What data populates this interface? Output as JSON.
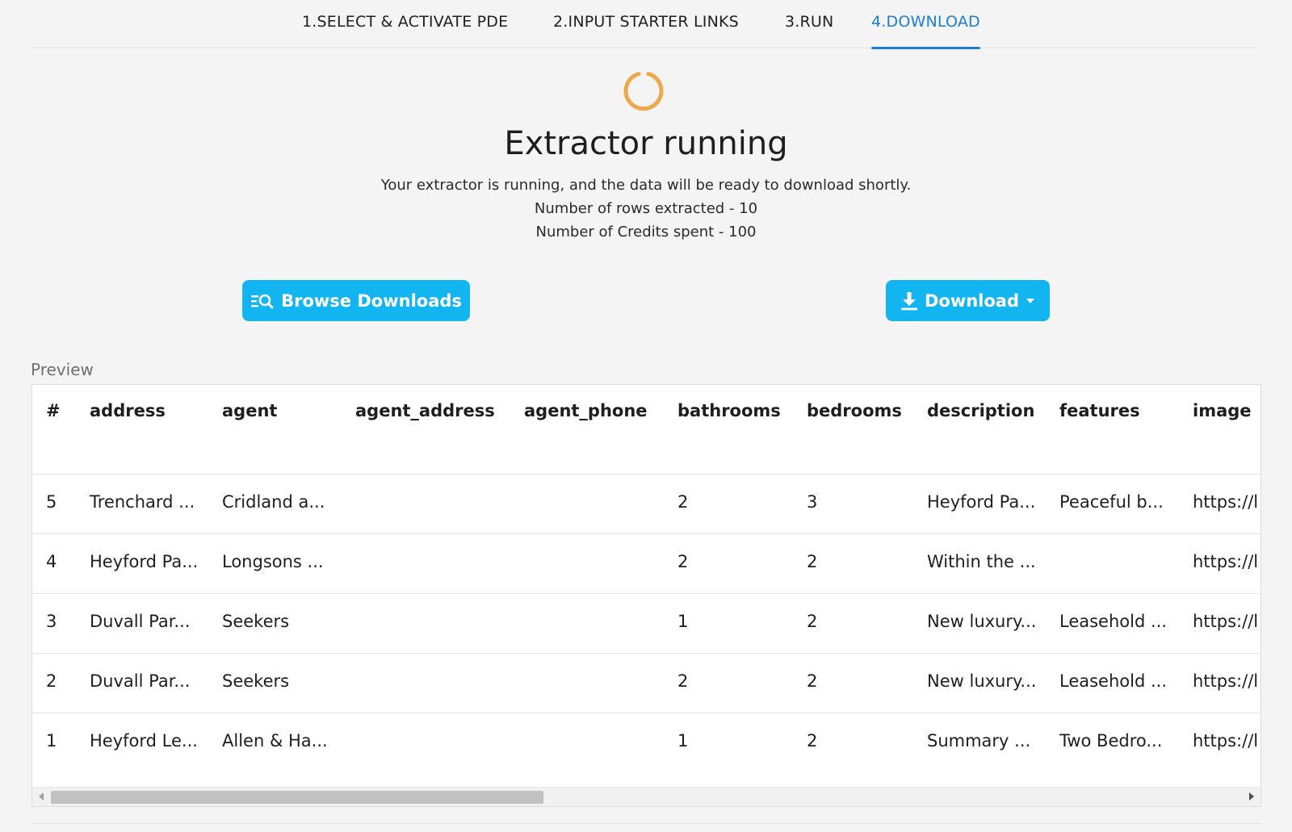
{
  "tabs": [
    {
      "label": "1.SELECT & ACTIVATE PDE"
    },
    {
      "label": "2.INPUT STARTER LINKS"
    },
    {
      "label": "3.RUN"
    },
    {
      "label": "4.DOWNLOAD",
      "active": true
    }
  ],
  "status": {
    "title": "Extractor running",
    "message": "Your extractor is running, and the data will be ready to download shortly.",
    "rows_extracted": "Number of rows extracted - 10",
    "credits_spent": "Number of Credits spent - 100"
  },
  "buttons": {
    "browse_label": "Browse Downloads",
    "download_label": "Download"
  },
  "preview": {
    "label": "Preview",
    "columns": [
      "#",
      "address",
      "agent",
      "agent_address",
      "agent_phone",
      "bathrooms",
      "bedrooms",
      "description",
      "features",
      "image"
    ],
    "rows": [
      [
        "5",
        "Trenchard ...",
        "Cridland a...",
        "",
        "",
        "2",
        "3",
        "Heyford Pa...",
        "Peaceful b...",
        "https://l"
      ],
      [
        "4",
        "Heyford Pa...",
        "Longsons ...",
        "",
        "",
        "2",
        "2",
        "Within the ...",
        "",
        "https://l"
      ],
      [
        "3",
        "Duvall Par...",
        "Seekers",
        "",
        "",
        "1",
        "2",
        "New luxury...",
        "Leasehold ...",
        "https://l"
      ],
      [
        "2",
        "Duvall Par...",
        "Seekers",
        "",
        "",
        "2",
        "2",
        "New luxury...",
        "Leasehold ...",
        "https://l"
      ],
      [
        "1",
        "Heyford Le...",
        "Allen & Ha...",
        "",
        "",
        "1",
        "2",
        "Summary ...",
        "Two Bedro...",
        "https://l"
      ]
    ]
  },
  "colors": {
    "accent": "#12b5ef",
    "tab_active": "#1b7fd6",
    "spinner": "#f0a74a"
  }
}
